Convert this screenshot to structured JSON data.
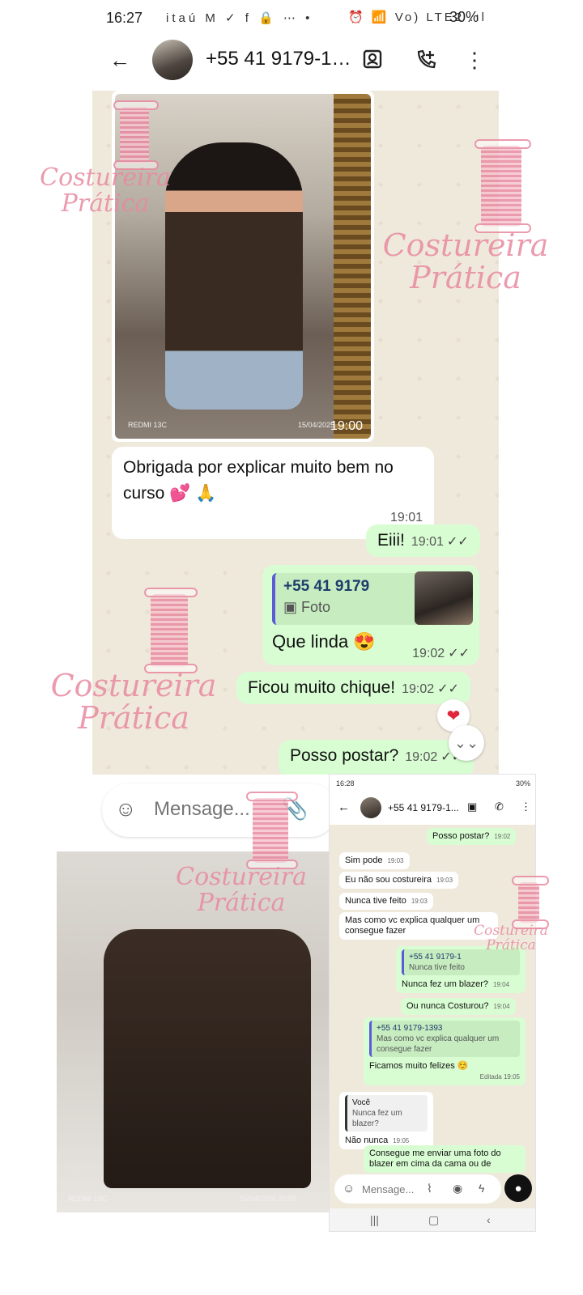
{
  "status_bar": {
    "time": "16:27",
    "left_icons": "itaú M ✓ f 🔒 ⋯ •",
    "right_icons": "⏰ 📶 Vo) LTE2 .ıl",
    "battery": "30%"
  },
  "header": {
    "contact": "+55 41 9179-1…"
  },
  "chat": {
    "photo": {
      "watermark": "REDMI 13C",
      "date": "15/04/2025",
      "time": "19:00"
    },
    "messages": [
      {
        "text": "Obrigada por explicar muito bem no curso 💕 🙏",
        "time": "19:01"
      },
      {
        "text": "Eiii!",
        "time": "19:01"
      },
      {
        "reply_name": "+55 41 9179",
        "reply_sub": "Foto",
        "text": "Que linda 😍",
        "time": "19:02"
      },
      {
        "text": "Ficou muito chique!",
        "time": "19:02"
      },
      {
        "text": "Posso postar?",
        "time": "19:02"
      }
    ],
    "reaction": "❤"
  },
  "composer": {
    "placeholder": "Mensage..."
  },
  "jacket_photo": {
    "watermark": "REDMI 13C",
    "date": "15/04/2025 20:59"
  },
  "inset": {
    "status_time": "16:28",
    "status_right": "30%",
    "contact": "+55 41 9179-1...",
    "messages": [
      {
        "dir": "out",
        "text": "Posso postar?",
        "time": "19:02"
      },
      {
        "dir": "in",
        "text": "Sim pode",
        "time": "19:03"
      },
      {
        "dir": "in",
        "text": "Eu não sou costureira",
        "time": "19:03"
      },
      {
        "dir": "in",
        "text": "Nunca tive feito",
        "time": "19:03"
      },
      {
        "dir": "in",
        "text": "Mas como vc explica qualquer um consegue fazer",
        "time": ""
      },
      {
        "dir": "out",
        "quote_name": "+55 41 9179-1",
        "quote_text": "Nunca tive feito",
        "text": "Nunca fez um blazer?",
        "time": "19:04"
      },
      {
        "dir": "out",
        "text": "Ou nunca Costurou?",
        "time": "19:04"
      },
      {
        "dir": "out",
        "quote_name": "+55 41 9179-1393",
        "quote_text": "Mas como vc explica qualquer um consegue fazer",
        "text": "Ficamos muito felizes ☺️",
        "time": "Editada 19:05"
      },
      {
        "dir": "in",
        "quote_name": "Você",
        "quote_text": "Nunca fez um blazer?",
        "text": "Não nunca",
        "time": "19:05"
      },
      {
        "dir": "out",
        "text": "Consegue me enviar uma foto do blazer em cima da cama ou de",
        "time": ""
      }
    ],
    "composer_placeholder": "Mensage..."
  },
  "watermark": {
    "line1": "Costureira",
    "line2": "Prática"
  },
  "colors": {
    "outgoing_bubble": "#d9fdd3",
    "chat_bg": "#efe9dc",
    "watermark": "#e88aa0"
  }
}
